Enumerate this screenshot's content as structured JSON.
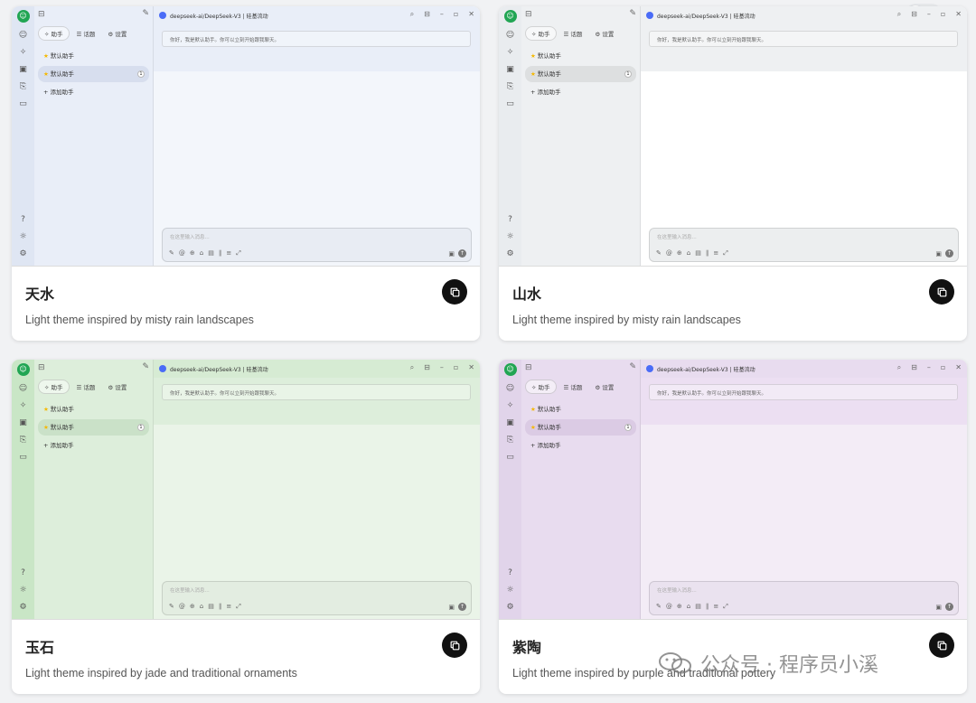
{
  "theme_cards": [
    {
      "name": "天水",
      "description": "Light theme inspired by misty rain landscapes",
      "colors": {
        "rail": "#dfe6f3",
        "side": "#e9eef8",
        "topbar": "#e9eef8",
        "msgzone": "#e9eef8",
        "chat": "#f3f6fb",
        "input": "#e8ecf3",
        "selected": "rgba(60,90,160,0.10)"
      }
    },
    {
      "name": "山水",
      "description": "Light theme inspired by misty rain landscapes",
      "colors": {
        "rail": "#e9ecef",
        "side": "#eef0f2",
        "topbar": "#eef0f2",
        "msgzone": "#eef0f2",
        "chat": "#ffffff",
        "input": "#eceeef",
        "selected": "rgba(0,0,0,0.07)"
      }
    },
    {
      "name": "玉石",
      "description": "Light theme inspired by jade and traditional ornaments",
      "colors": {
        "rail": "#c9e6c6",
        "side": "#ddeedb",
        "topbar": "#d6ebd3",
        "msgzone": "#ddeedb",
        "chat": "#eaf4e8",
        "input": "#e3ede1",
        "selected": "rgba(40,120,40,0.10)"
      }
    },
    {
      "name": "紫陶",
      "description": "Light theme inspired by purple and traditional pottery",
      "colors": {
        "rail": "#e1d4ea",
        "side": "#e8dcef",
        "topbar": "#e8dcef",
        "msgzone": "#ecdff2",
        "chat": "#f3ecf6",
        "input": "#eae2ef",
        "selected": "rgba(110,60,140,0.10)"
      }
    }
  ],
  "mock_app": {
    "tabs": [
      "✧ 助手",
      "☰ 话题",
      "⚙ 设置"
    ],
    "items": [
      "默认助手",
      "默认助手"
    ],
    "selected_count": "1",
    "add_label": "+ 添加助手",
    "model_title": "deepseek-ai/DeepSeek-V3 | 硅基流动",
    "greeting": "你好，我是默认助手。你可以立刻开始跟我聊天。",
    "input_placeholder": "在这里输入消息...",
    "rail_icons": [
      "chat-icon",
      "sparkle-icon",
      "image-icon",
      "translate-icon",
      "folder-icon"
    ],
    "rail_bottom_icons": [
      "help-icon",
      "sun-icon",
      "settings-icon"
    ],
    "tool_icons": [
      "edit-icon",
      "at-icon",
      "globe-icon",
      "knowledge-icon",
      "file-icon",
      "attach-icon",
      "list-icon",
      "expand-icon"
    ]
  },
  "mode_toggle": {
    "state": "light"
  },
  "watermark": "公众号 · 程序员小溪"
}
